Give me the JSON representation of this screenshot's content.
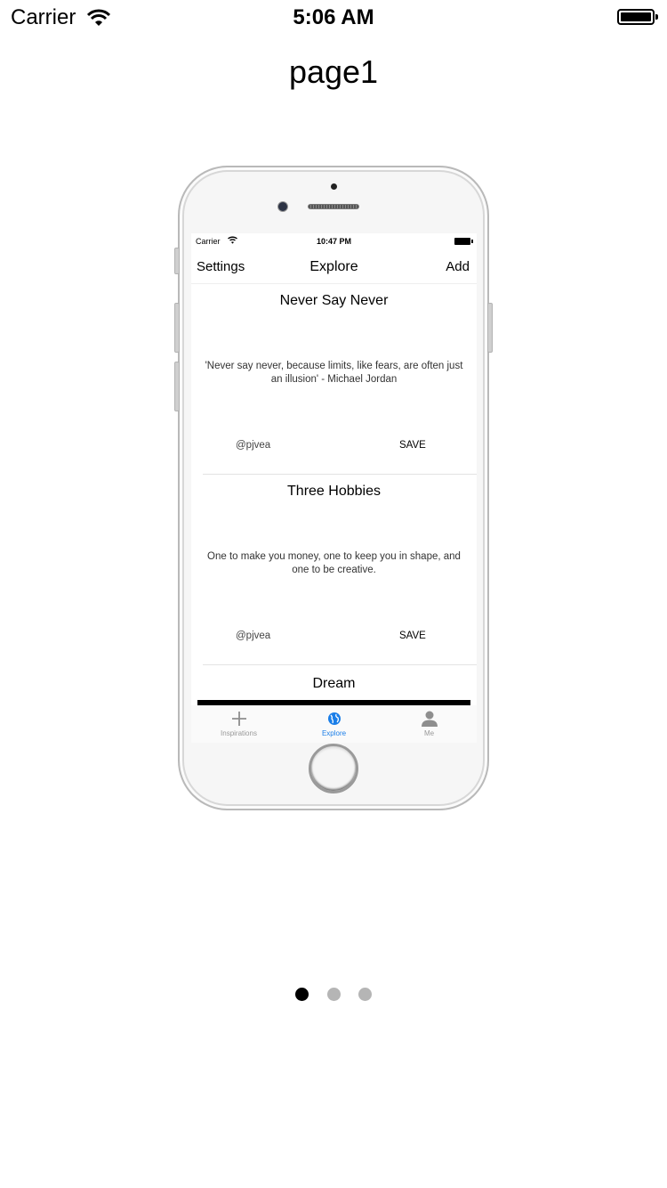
{
  "status_bar": {
    "carrier": "Carrier",
    "time": "5:06 AM"
  },
  "page": {
    "title": "page1",
    "page_count": 3,
    "current_page_index": 0
  },
  "phone": {
    "status_bar": {
      "carrier": "Carrier",
      "time": "10:47 PM"
    },
    "nav": {
      "left": "Settings",
      "title": "Explore",
      "right": "Add"
    },
    "cards": [
      {
        "title": "Never Say Never",
        "quote": "'Never say never, because limits, like fears, are often just an illusion' - Michael Jordan",
        "user": "@pjvea",
        "save": "SAVE"
      },
      {
        "title": "Three Hobbies",
        "quote": "One to make you money, one to keep you in shape, and one to be creative.",
        "user": "@pjvea",
        "save": "SAVE"
      },
      {
        "title": "Dream"
      }
    ],
    "tabs": [
      {
        "label": "Inspirations",
        "icon": "plus-icon"
      },
      {
        "label": "Explore",
        "icon": "globe-icon",
        "active": true
      },
      {
        "label": "Me",
        "icon": "person-icon"
      }
    ],
    "accent_color": "#1a7ee8"
  }
}
